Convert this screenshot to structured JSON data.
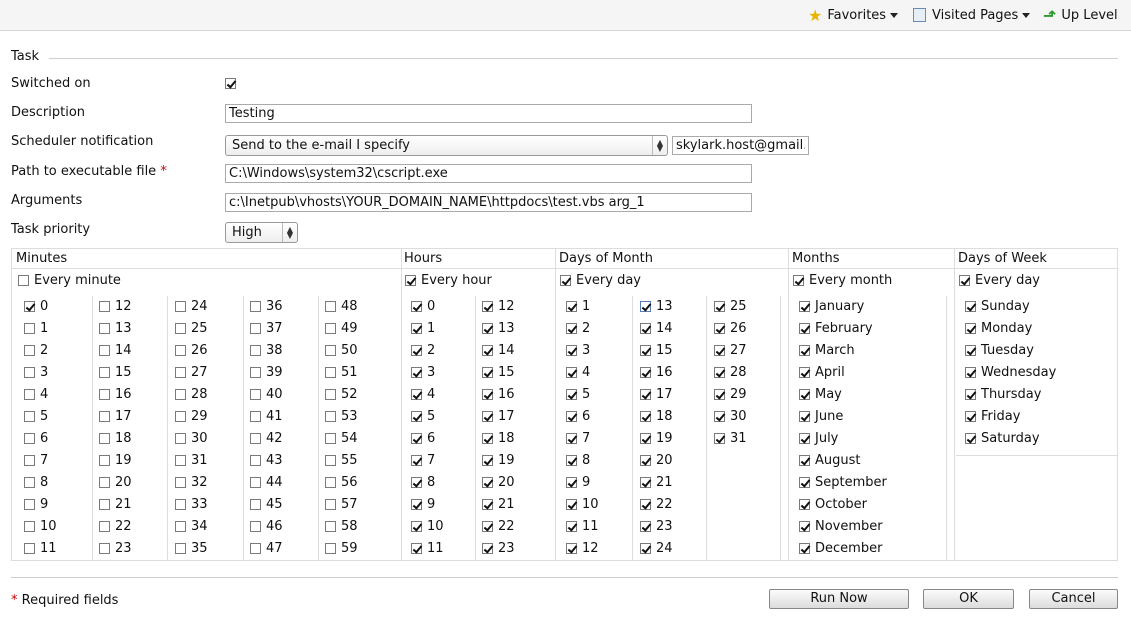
{
  "toolbar": {
    "favorites": "Favorites",
    "visited_pages": "Visited Pages",
    "up_level": "Up Level"
  },
  "form": {
    "section_title": "Task",
    "switched_on_label": "Switched on",
    "switched_on": true,
    "description_label": "Description",
    "description_value": "Testing",
    "notification_label": "Scheduler notification",
    "notification_value": "Send to the e-mail I specify",
    "email_value": "skylark.host@gmail.cc",
    "path_label": "Path to executable file",
    "required_mark": "*",
    "path_value": "C:\\Windows\\system32\\cscript.exe",
    "arguments_label": "Arguments",
    "arguments_value": "c:\\Inetpub\\vhosts\\YOUR_DOMAIN_NAME\\httpdocs\\test.vbs arg_1",
    "priority_label": "Task priority",
    "priority_value": "High"
  },
  "schedule": {
    "minutes_header": "Minutes",
    "hours_header": "Hours",
    "days_header": "Days of Month",
    "months_header": "Months",
    "weekdays_header": "Days of Week",
    "every_minute": "Every minute",
    "every_minute_checked": false,
    "every_hour": "Every hour",
    "every_hour_checked": true,
    "every_day": "Every day",
    "every_day_checked": true,
    "every_month": "Every month",
    "every_month_checked": true,
    "every_weekday": "Every day",
    "every_weekday_checked": true,
    "minutes_checked": [
      0
    ],
    "hours_checked": "all",
    "days_checked": "all",
    "months": [
      "January",
      "February",
      "March",
      "April",
      "May",
      "June",
      "July",
      "August",
      "September",
      "October",
      "November",
      "December"
    ],
    "weekdays": [
      "Sunday",
      "Monday",
      "Tuesday",
      "Wednesday",
      "Thursday",
      "Friday",
      "Saturday"
    ]
  },
  "footer": {
    "required_note": "Required fields",
    "run_now": "Run Now",
    "ok": "OK",
    "cancel": "Cancel"
  },
  "icons": {
    "favorites": "star-icon",
    "visited": "pages-icon",
    "up": "up-arrow-icon"
  }
}
